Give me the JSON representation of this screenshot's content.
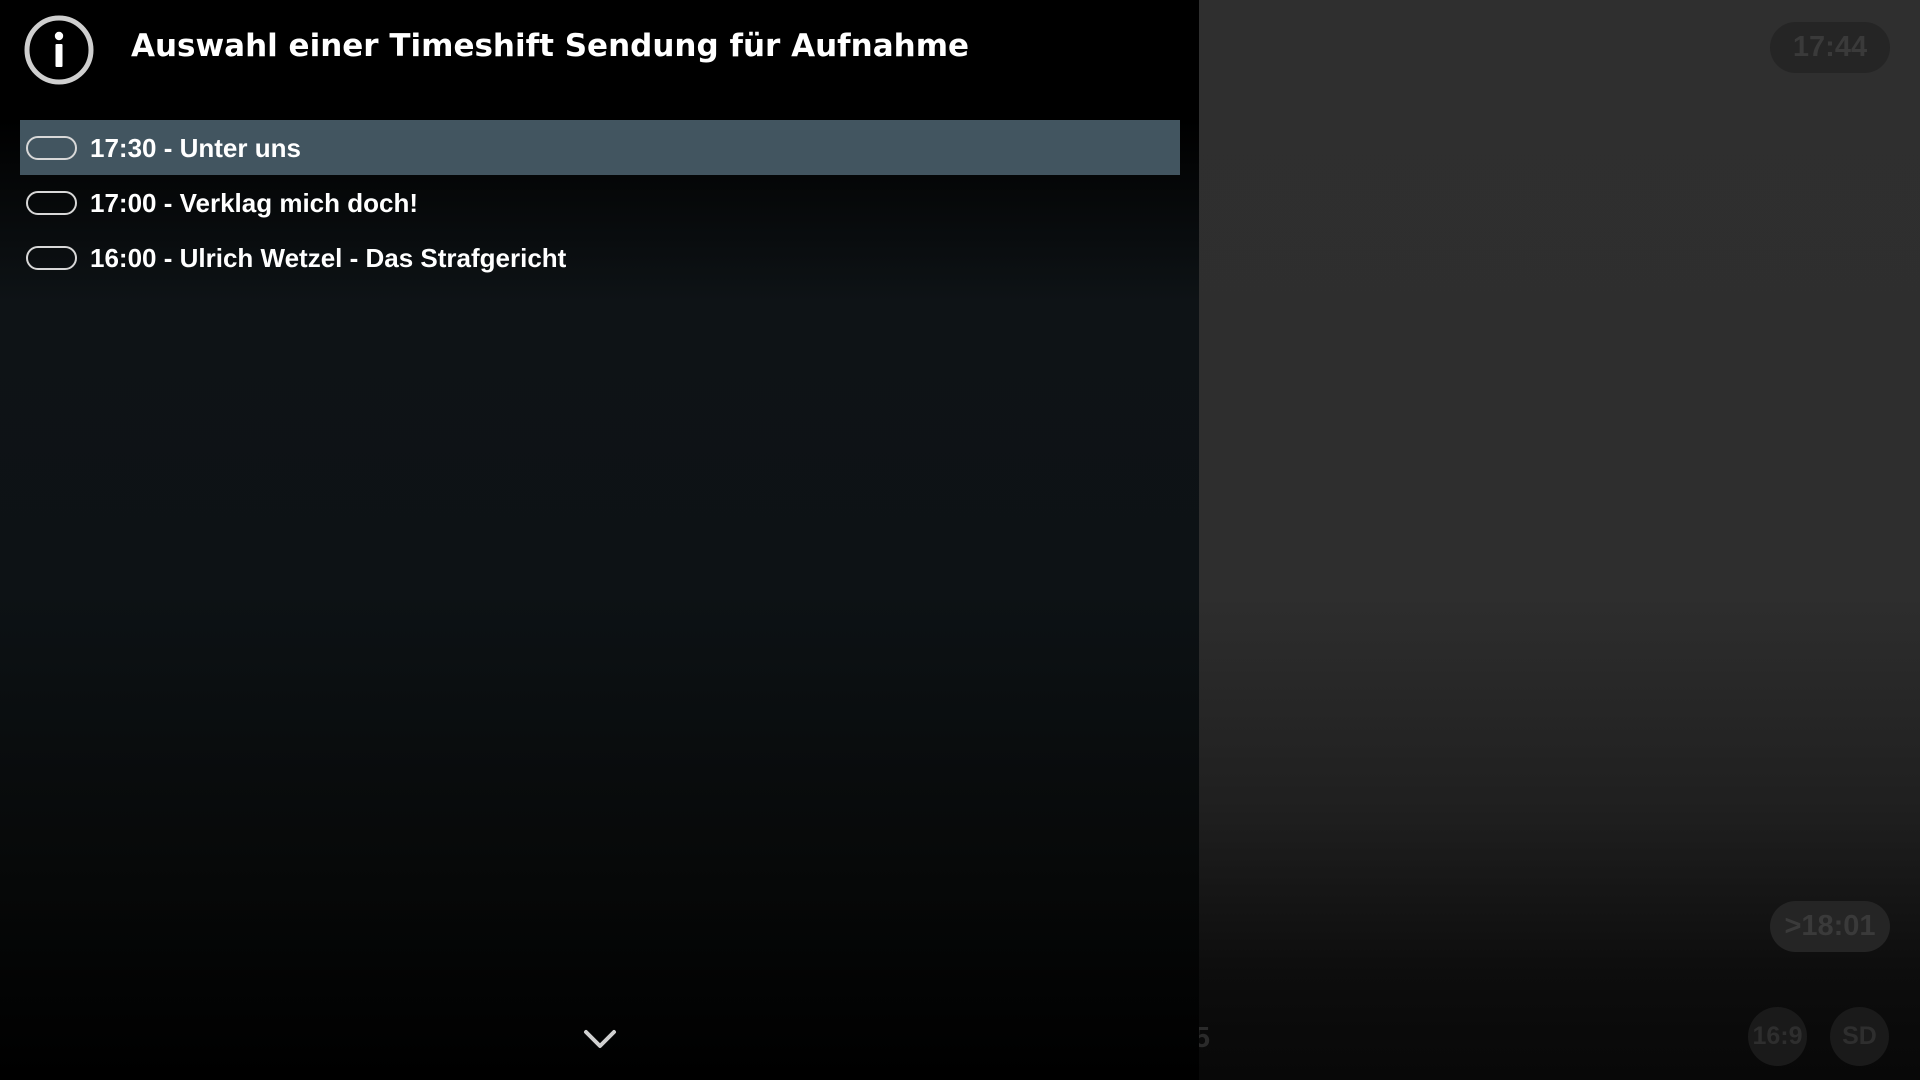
{
  "dialog": {
    "title": "Auswahl einer Timeshift Sendung für Aufnahme",
    "header_icon": "info-icon",
    "items": [
      {
        "label": "17:30 - Unter uns",
        "selected": true
      },
      {
        "label": "17:00 - Verklag mich doch!",
        "selected": false
      },
      {
        "label": "16:00 - Ulrich Wetzel - Das Strafgericht",
        "selected": false
      }
    ],
    "scroll_icon": "chevron-down-icon"
  },
  "osd": {
    "clock": "17:44",
    "end_time": ">18:01",
    "aspect": "16:9",
    "resolution": "SD",
    "partial_text": "5"
  },
  "colors": {
    "selected_row": "#425560",
    "text": "#ffffff",
    "radio_border": "#d8d8d8"
  }
}
